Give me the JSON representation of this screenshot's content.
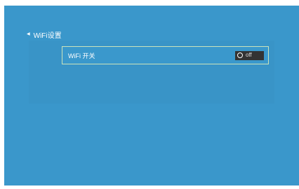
{
  "header": {
    "back_icon": "chevron-left-icon",
    "title": "WiFi设置"
  },
  "settings": [
    {
      "label": "WiFi 开关",
      "toggle": {
        "state_text": "off",
        "value": false
      }
    }
  ],
  "colors": {
    "background": "#3a97cb",
    "row_border": "#cbe3ba",
    "toggle_bg": "#333333",
    "text": "#ffffff"
  }
}
